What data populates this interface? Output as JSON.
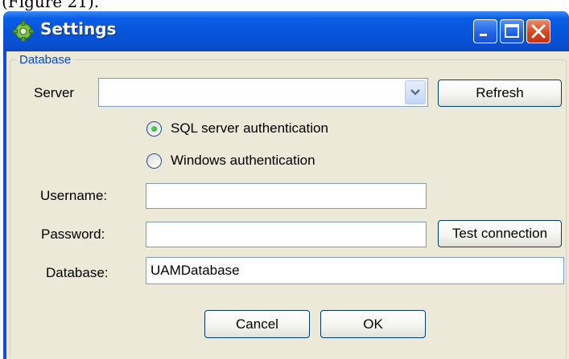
{
  "caption": "(Figure 21).",
  "window": {
    "title": "Settings",
    "controls": {
      "minimize_icon": "minimize-icon",
      "maximize_icon": "maximize-icon",
      "close_icon": "close-icon"
    }
  },
  "group": {
    "label": "Database"
  },
  "server": {
    "label": "Server",
    "value": "",
    "refresh_label": "Refresh"
  },
  "auth": {
    "options": [
      {
        "label": "SQL server authentication",
        "selected": true
      },
      {
        "label": "Windows authentication",
        "selected": false
      }
    ]
  },
  "fields": {
    "username_label": "Username:",
    "username_value": "",
    "password_label": "Password:",
    "password_value": "",
    "test_label": "Test connection",
    "database_label": "Database:",
    "database_value": "UAMDatabase"
  },
  "buttons": {
    "cancel_label": "Cancel",
    "ok_label": "OK"
  },
  "colors": {
    "title_blue": "#0a4fd6",
    "panel": "#ece9d8",
    "group_label": "#0046d5",
    "radio_dot": "#21a121"
  }
}
